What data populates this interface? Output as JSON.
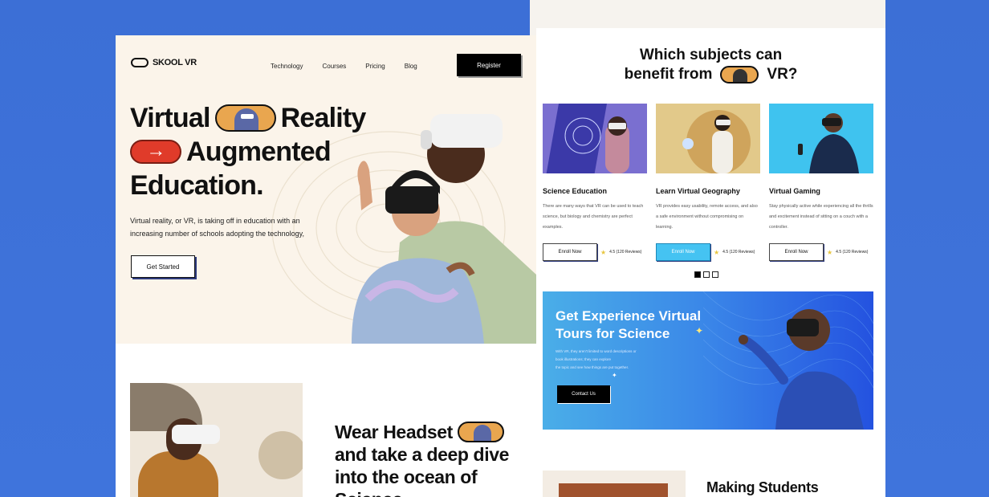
{
  "brand": {
    "logo_text": "SKOOL VR"
  },
  "nav": {
    "items": [
      "Technology",
      "Courses",
      "Pricing",
      "Blog"
    ],
    "register_label": "Register"
  },
  "hero": {
    "title_line1_a": "Virtual",
    "title_line1_b": "Reality",
    "title_line2": "Augmented",
    "title_line3": "Education.",
    "lead": "Virtual reality, or VR, is taking off in education with an increasing number of schools adopting the technology,",
    "cta_label": "Get Started"
  },
  "section2": {
    "line1": "Wear Headset",
    "line2": "and take a deep dive",
    "line3": "into the ocean of",
    "line4": "Science"
  },
  "subjects": {
    "title_line1": "Which subjects can",
    "title_line2_a": "benefit from",
    "title_line2_b": "VR?",
    "cards": [
      {
        "title": "Science Education",
        "desc": "There are many ways that VR can be used to teach science, but biology and chemistry are perfect examples.",
        "button": "Enroll Now",
        "rating": "4.5 (120 Reviews)"
      },
      {
        "title": "Learn Virtual Geography",
        "desc": "VR provides easy usability, remote access, and also a safe environment without compromising on learning.",
        "button": "Enroll Now",
        "rating": "4.5 (120 Reviews)"
      },
      {
        "title": "Virtual Gaming",
        "desc": "Stay physically active while experiencing all the thrills and excitement instead of sitting on a couch with a controller.",
        "button": "Enroll Now",
        "rating": "4.5 (120 Reviews)"
      }
    ],
    "active_dot": 0,
    "dot_count": 3
  },
  "banner": {
    "title": "Get Experience Virtual Tours for Science",
    "desc_line1": "With VR, they aren't limited to word descriptions or",
    "desc_line2": "book illustrations; they can explore",
    "desc_line3": "the topic and see how things are put together.",
    "cta_label": "Contact Us"
  },
  "section3": {
    "title": "Making Students"
  },
  "colors": {
    "accent_red": "#e03b2a",
    "accent_orange": "#e9a64f",
    "accent_blue": "#45c3f2",
    "page_bg": "#3f72d8",
    "hero_bg": "#fbf4ea"
  }
}
